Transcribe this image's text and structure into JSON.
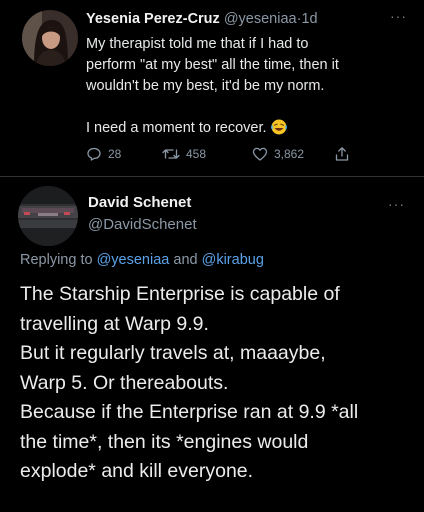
{
  "tweet": {
    "author_name": "Yesenia Perez-Cruz",
    "author_handle": "@yeseniaa",
    "separator": "·",
    "time": "1d",
    "more": "···",
    "lines": [
      "My therapist told me that if I had to",
      "perform \"at my best\" all the time, then it",
      "wouldn't be my best, it'd be my norm."
    ],
    "last_line": "I need a moment to recover.",
    "emoji": "laughing-crying-emoji",
    "replies": "28",
    "retweets": "458",
    "likes": "3,862"
  },
  "reply": {
    "author_name": "David Schenet",
    "author_handle": "@DavidSchenet",
    "more": "···",
    "replying_to_label": "Replying to",
    "mention_1": "@yeseniaa",
    "and": "and",
    "mention_2": "@kirabug",
    "lines": [
      "The Starship Enterprise is capable of",
      "travelling at Warp 9.9.",
      "But it regularly travels at, maaaybe,",
      "Warp 5. Or thereabouts.",
      "Because if the Enterprise ran at 9.9 *all",
      "the time*, then its *engines would",
      "explode* and kill everyone."
    ]
  },
  "colors": {
    "background": "#000000",
    "text": "#e7e9ea",
    "secondary": "#8b98a5",
    "mention": "#5aa2e8",
    "divider": "#2f3336"
  },
  "icons": [
    "reply-icon",
    "retweet-icon",
    "like-icon",
    "share-icon",
    "more-icon"
  ]
}
